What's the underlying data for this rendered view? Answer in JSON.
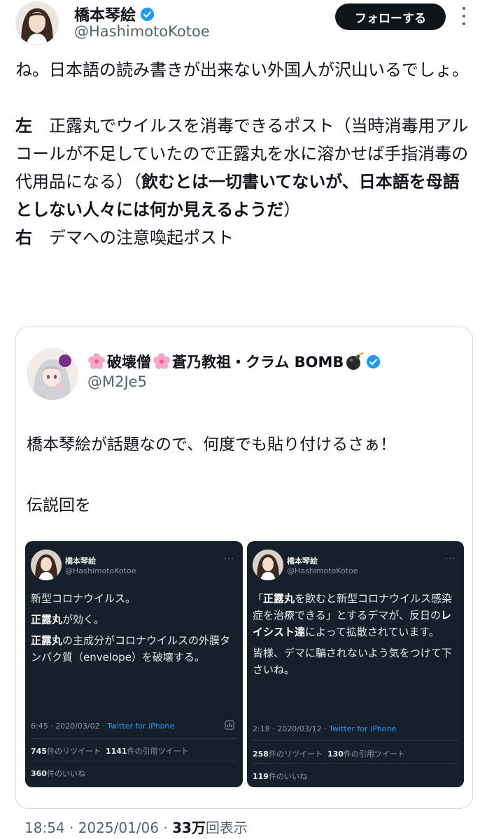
{
  "author": {
    "name": "橋本琴絵",
    "handle": "@HashimotoKotoe",
    "follow_label": "フォローする"
  },
  "tweet": {
    "line1": "ね。日本語の読み書きが出来ない外国人が沢山いるでしょ。",
    "left_tag": "左",
    "left_text": "正露丸でウイルスを消毒できるポスト（当時消毒用アルコールが不足していたので正露丸を水に溶かせば手指消毒の代用品になる）（",
    "left_bold": "飲むとは一切書いてないが、日本語を母語としない人々には何か見えるようだ",
    "left_close": "）",
    "right_tag": "右",
    "right_text": "デマへの注意喚起ポスト"
  },
  "quote": {
    "name": "破壊僧",
    "name2": "蒼乃教祖・クラム BOMB",
    "handle": "@M2Je5",
    "text1": "橋本琴絵が話題なので、何度でも貼り付けるさぁ！",
    "text2": "伝説回を"
  },
  "shot_left": {
    "name": "橋本琴絵",
    "handle": "@HashimotoKotoe",
    "p1": "新型コロナウイルス。",
    "p2_bold": "正露丸",
    "p2": "が効く。",
    "p3_bold": "正露丸",
    "p3": "の主成分がコロナウイルスの外膜タンパク質（envelope）を破壊する。",
    "time": "6:45 · 2020/03/02 · ",
    "source": "Twitter for iPhone",
    "rt_count": "745",
    "rt_label": "件のリツイート",
    "qt_count": "1141",
    "qt_label": "件の引用ツイート",
    "like_count": "360",
    "like_label": "件のいいね"
  },
  "shot_right": {
    "name": "橋本琴絵",
    "handle": "@HashimotoKotoe",
    "p1a": "「",
    "p1_bold": "正露丸",
    "p1b": "を飲むと新型コロナウイルス感染症を治療できる」とするデマが、反日の",
    "p1_bold2": "レイシスト達",
    "p1c": "によって拡散されています。",
    "p2": "皆様、デマに騙されないよう気をつけて下さいね。",
    "time": "2:18 · 2020/03/12 · ",
    "source": "Twitter for iPhone",
    "rt_count": "258",
    "rt_label": "件のリツイート",
    "qt_count": "130",
    "qt_label": "件の引用ツイート",
    "like_count": "119",
    "like_label": "件のいいね"
  },
  "footer": {
    "time": "18:54 · 2025/01/06 · ",
    "views": "33万",
    "views_label": "回表示"
  },
  "icons": {
    "verified": "verified-badge-icon",
    "more": "more-dots-icon",
    "flower": "cherry-blossom-icon",
    "bomb": "bomb-icon",
    "analytics": "analytics-icon"
  },
  "colors": {
    "verified": "#1d9bf0",
    "dark_card": "#15202b",
    "muted": "#536471"
  }
}
